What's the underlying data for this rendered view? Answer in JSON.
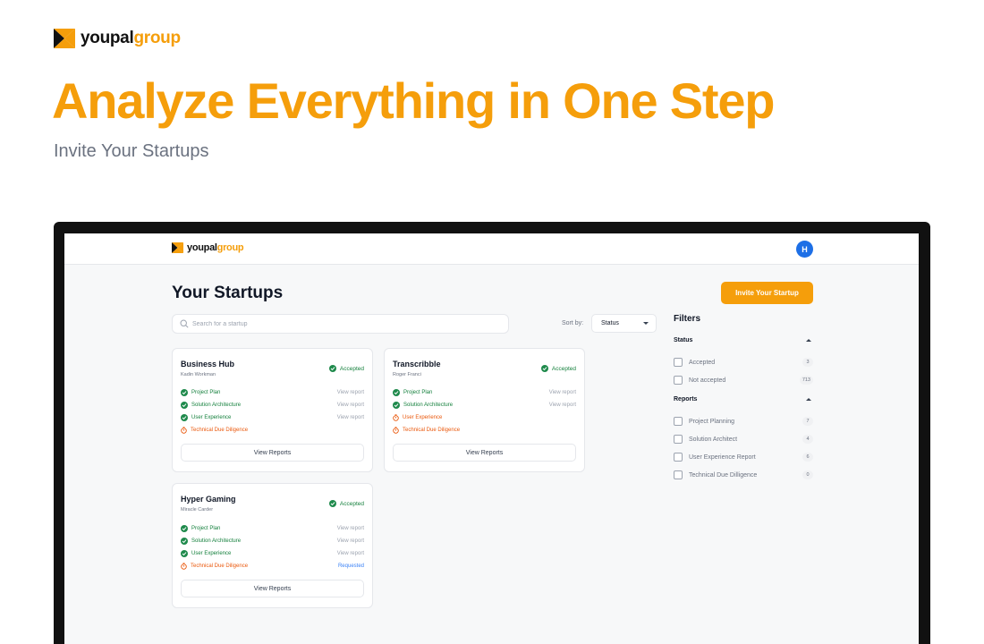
{
  "brand": {
    "part1": "youpal",
    "part2": "group",
    "accent": "#f59e0b"
  },
  "hero": {
    "title": "Analyze Everything in One Step",
    "subtitle": "Invite Your Startups"
  },
  "app": {
    "avatar_initial": "H",
    "page_title": "Your Startups",
    "invite_button": "Invite Your Startup",
    "search_placeholder": "Search for a startup",
    "sort_label": "Sort by:",
    "sort_value": "Status",
    "view_reports_label": "View Reports",
    "cards": [
      {
        "name": "Business Hub",
        "owner": "Kadin Workman",
        "status": "Accepted",
        "reports": [
          {
            "label": "Project Plan",
            "state": "done",
            "action": "View report"
          },
          {
            "label": "Solution Architecture",
            "state": "done",
            "action": "View report"
          },
          {
            "label": "User Experience",
            "state": "done",
            "action": "View report"
          },
          {
            "label": "Technical Due Diligence",
            "state": "pending",
            "action": ""
          }
        ]
      },
      {
        "name": "Transcribble",
        "owner": "Roger Franci",
        "status": "Accepted",
        "reports": [
          {
            "label": "Project Plan",
            "state": "done",
            "action": "View report"
          },
          {
            "label": "Solution Architecture",
            "state": "done",
            "action": "View report"
          },
          {
            "label": "User Experience",
            "state": "pending",
            "action": ""
          },
          {
            "label": "Technical Due Diligence",
            "state": "pending",
            "action": ""
          }
        ]
      },
      {
        "name": "Hyper Gaming",
        "owner": "Miracle Carder",
        "status": "Accepted",
        "reports": [
          {
            "label": "Project Plan",
            "state": "done",
            "action": "View report"
          },
          {
            "label": "Solution Architecture",
            "state": "done",
            "action": "View report"
          },
          {
            "label": "User Experience",
            "state": "done",
            "action": "View report"
          },
          {
            "label": "Technical Due Diligence",
            "state": "pending",
            "action": "Requested"
          }
        ]
      }
    ],
    "filters": {
      "title": "Filters",
      "status": {
        "label": "Status",
        "items": [
          {
            "label": "Accepted",
            "count": "3"
          },
          {
            "label": "Not accepted",
            "count": "713"
          }
        ]
      },
      "reports": {
        "label": "Reports",
        "items": [
          {
            "label": "Project Planning",
            "count": "7"
          },
          {
            "label": "Solution Architect",
            "count": "4"
          },
          {
            "label": "User Experience Report",
            "count": "6"
          },
          {
            "label": "Technical Due Dilligence",
            "count": "0"
          }
        ]
      }
    }
  }
}
